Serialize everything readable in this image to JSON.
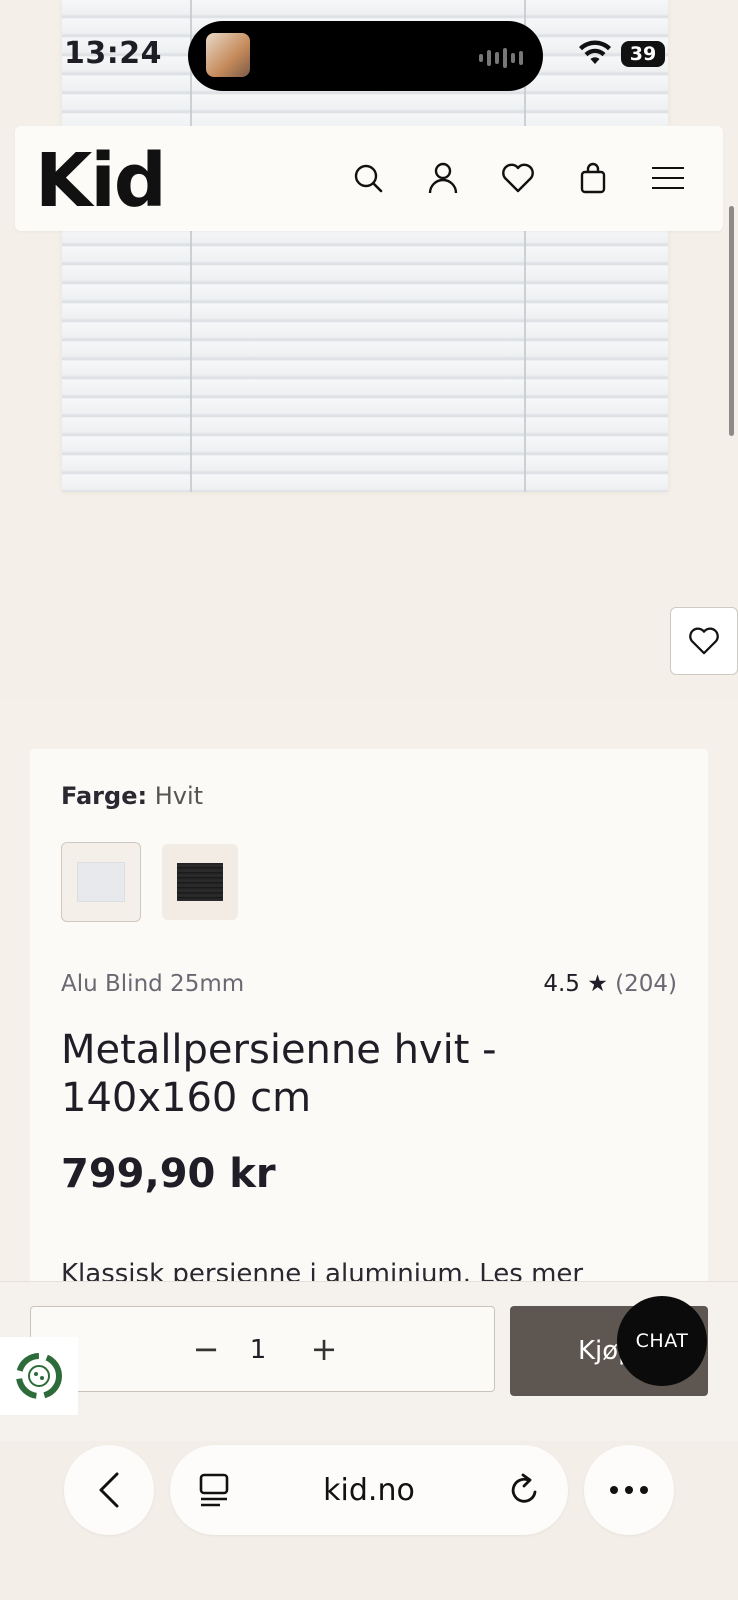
{
  "status_bar": {
    "time": "13:24",
    "battery": "39"
  },
  "header": {
    "logo": "Kid"
  },
  "product": {
    "color_label": "Farge:",
    "color_value": "Hvit",
    "brand": "Alu Blind 25mm",
    "rating": "4.5 ★",
    "review_count": "(204)",
    "title": "Metallpersienne hvit - 140x160 cm",
    "price": "799,90 kr",
    "description": "Klassisk persienne i aluminium. Les mer",
    "swatches": [
      "Hvit",
      "Svart"
    ]
  },
  "buy_bar": {
    "quantity": "1",
    "buy_label": "Kjøp",
    "chat_label": "CHAT"
  },
  "browser": {
    "url": "kid.no"
  },
  "colors": {
    "accent_buy": "#5e5650",
    "background": "#f5f0e9",
    "chat": "#0b0b0b"
  }
}
